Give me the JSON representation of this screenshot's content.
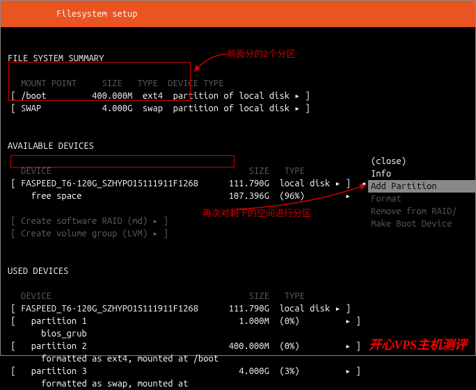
{
  "header": {
    "title": "Filesystem setup"
  },
  "summary": {
    "title": "FILE SYSTEM SUMMARY",
    "head": {
      "mount": "MOUNT POINT",
      "size": "SIZE",
      "type": "TYPE",
      "devtype": "DEVICE TYPE"
    },
    "rows": [
      {
        "mount": "/boot",
        "size": "400.000M",
        "type": "ext4",
        "devtype": "partition of local disk ▸"
      },
      {
        "mount": "SWAP",
        "size": "4.000G",
        "type": "swap",
        "devtype": "partition of local disk ▸"
      }
    ]
  },
  "available": {
    "title": "AVAILABLE DEVICES",
    "head": {
      "device": "DEVICE",
      "size": "SIZE",
      "type": "TYPE"
    },
    "disk": {
      "name": "FASPEED_T6-120G_SZHYPO15111911F1268",
      "size": "111.790G",
      "type": "local disk ▸"
    },
    "free": {
      "label": "free space",
      "size": "107.396G",
      "pct": "(96%)",
      "arrow": "▸"
    },
    "raid": "Create software RAID (md) ▸",
    "lvm": "Create volume group (LVM) ▸"
  },
  "menu": {
    "close": "(close)",
    "info": "Info",
    "add": "Add Partition",
    "format": "Format",
    "remove": "Remove from RAID/",
    "boot": "Make Boot Device"
  },
  "used": {
    "title": "USED DEVICES",
    "head": {
      "device": "DEVICE",
      "size": "SIZE",
      "type": "TYPE"
    },
    "disk": {
      "name": "FASPEED_T6-120G_SZHYPO15111911F1268",
      "size": "111.790G",
      "type": "local disk ▸"
    },
    "p1": {
      "name": "partition 1",
      "size": "1.000M",
      "pct": "(0%)",
      "arrow": "▸",
      "desc": "bios_grub"
    },
    "p2": {
      "name": "partition 2",
      "size": "400.000M",
      "pct": "(0%)",
      "arrow": "▸",
      "desc": "formatted as ext4, mounted at /boot"
    },
    "p3": {
      "name": "partition 3",
      "size": "4.000G",
      "pct": "(3%)",
      "arrow": "▸",
      "desc": "formatted as swap, mounted at"
    }
  },
  "annot": {
    "a1": "前面分的2个分区",
    "a2": "再次对剩下的空间进行分区"
  },
  "watermark": "开心VPS主机测评",
  "menu_marker": "◂"
}
